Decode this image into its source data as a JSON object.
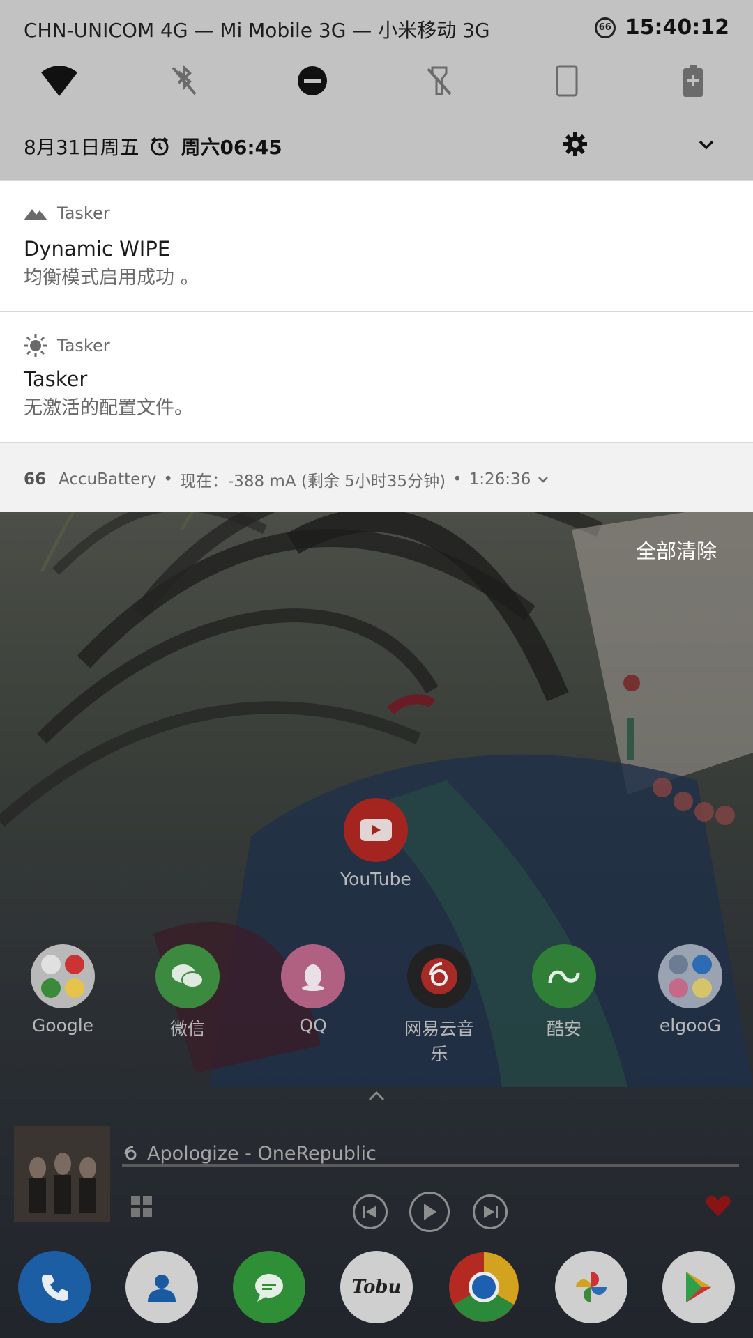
{
  "status_bar": {
    "carriers": "CHN-UNICOM 4G — Mi Mobile 3G — 小米移动 3G",
    "battery_badge": "66",
    "time": "15:40:12"
  },
  "quick_settings": {
    "tiles": [
      "wifi-icon",
      "bluetooth-off-icon",
      "do-not-disturb-icon",
      "flashlight-off-icon",
      "auto-rotate-icon",
      "battery-saver-icon"
    ],
    "date": "8月31日周五",
    "alarm": "周六06:45"
  },
  "notifications": [
    {
      "app": "Tasker",
      "icon": "mountain-icon",
      "title": "Dynamic WIPE",
      "text": "均衡模式启用成功 。"
    },
    {
      "app": "Tasker",
      "icon": "sun-icon",
      "title": "Tasker",
      "text": "无激活的配置文件。"
    }
  ],
  "battery_notification": {
    "badge": "66",
    "app": "AccuBattery",
    "text": "现在：-388 mA (剩余 5小时35分钟)",
    "time": "1:26:36"
  },
  "clear_all": "全部清除",
  "home": {
    "apps_row1": [
      {
        "label": "YouTube",
        "color": "#b3231e"
      }
    ],
    "apps_row2": [
      {
        "label": "Google",
        "color": "#bdbdbd"
      },
      {
        "label": "微信",
        "color": "#3aa043"
      },
      {
        "label": "QQ",
        "color": "#c06a8a"
      },
      {
        "label": "网易云音乐",
        "color": "#2a2a2a"
      },
      {
        "label": "酷安",
        "color": "#2f8f3a"
      },
      {
        "label": "elgooG",
        "color": "#9aa6b8"
      }
    ],
    "music": {
      "song": "Apologize - OneRepublic"
    },
    "dock": [
      "phone-icon",
      "contacts-icon",
      "messages-icon",
      "tobu-icon",
      "chrome-icon",
      "photos-icon",
      "play-store-icon"
    ],
    "dock_labels": {
      "tobu": "Tobu"
    }
  }
}
